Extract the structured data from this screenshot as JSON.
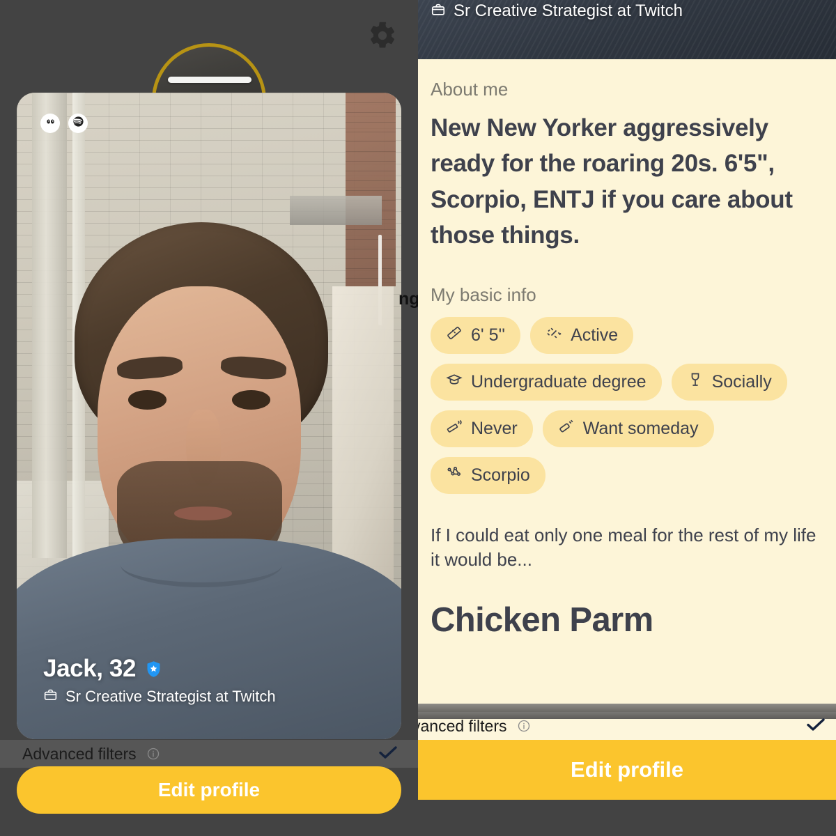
{
  "theme": {
    "background": "#434343",
    "accent_yellow": "#fbc52d",
    "chip_bg": "#fbe3a0",
    "cream_bg": "#fdf5d8",
    "text_dark": "#3e414c",
    "verified_blue": "#2196f3"
  },
  "left_panel": {
    "gear_icon": "gear-icon",
    "photo_badges": [
      {
        "icon": "eyes-icon",
        "name": "prompt-eyes-badge"
      },
      {
        "icon": "spotify-icon",
        "name": "spotify-badge"
      }
    ],
    "profile_name": "Jack, 32",
    "verified_icon": "verified-shield-icon",
    "job_icon": "briefcase-icon",
    "job_title": "Sr Creative Strategist at Twitch",
    "filters_label": "Advanced filters",
    "filters_info_icon": "info-icon",
    "filters_check_icon": "check-icon",
    "edit_button_label": "Edit profile"
  },
  "right_panel": {
    "job_icon": "briefcase-icon",
    "job_title": "Sr Creative Strategist at Twitch",
    "about_label": "About me",
    "bio": "New New Yorker aggressively ready for the roaring 20s. 6'5\", Scorpio, ENTJ if you care about those things.",
    "basic_info_label": "My basic info",
    "chips": [
      {
        "icon": "ruler-icon",
        "label": "6' 5''"
      },
      {
        "icon": "dumbbell-icon",
        "label": "Active"
      },
      {
        "icon": "graduation-cap-icon",
        "label": "Undergraduate degree"
      },
      {
        "icon": "wine-glass-icon",
        "label": "Socially"
      },
      {
        "icon": "cigarette-icon",
        "label": "Never"
      },
      {
        "icon": "baby-bottle-icon",
        "label": "Want someday"
      },
      {
        "icon": "constellation-icon",
        "label": "Scorpio"
      }
    ],
    "prompt_question": "If I could eat only one meal for the rest of my life it would be...",
    "prompt_answer": "Chicken Parm",
    "filters_label": "vanced filters",
    "filters_info_icon": "info-icon",
    "filters_check_icon": "check-icon",
    "edit_button_label": "Edit profile"
  },
  "background_partial_text": "ng"
}
